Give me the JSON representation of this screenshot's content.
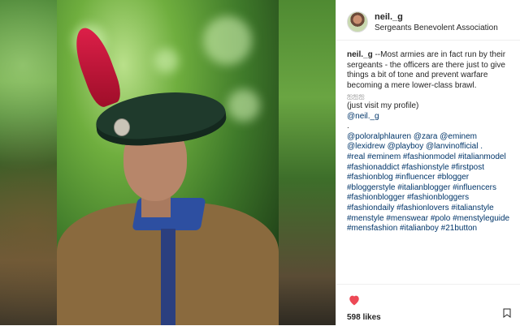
{
  "post": {
    "username": "neil._g",
    "location": "Sergeants Benevolent Association",
    "likes": "598 likes",
    "caption": {
      "author": "neil._g",
      "lines": [
        " --Most armies are in fact run by their",
        "sergeants - the officers are there just to give",
        "things a bit of tone and prevent warfare",
        "becoming a mere lower-class brawl.",
        "ஐஐஐ",
        "(just visit my profile)",
        "@neil._g",
        ".",
        "@poloralphlauren @zara @eminem",
        "@lexidrew @playboy @lanvinofficial .",
        "#real #eminem #fashionmodel #italianmodel",
        "#fashionaddict #fashionstyle #firstpost",
        "#fashionblog #influencer #blogger",
        "#bloggerstyle #italianblogger #influencers",
        "#fashionblogger #fashionbloggers",
        "#fashiondaily #fashionlovers #italianstyle",
        "#menstyle #menswear #polo #menstyleguide",
        "#mensfashion #italianboy #21button"
      ]
    }
  },
  "icons": {
    "heart": "heart-icon",
    "avatar": "avatar",
    "save": "bookmark-icon"
  },
  "colors": {
    "heart": "#ed4956",
    "link": "#003569",
    "text": "#262626"
  }
}
